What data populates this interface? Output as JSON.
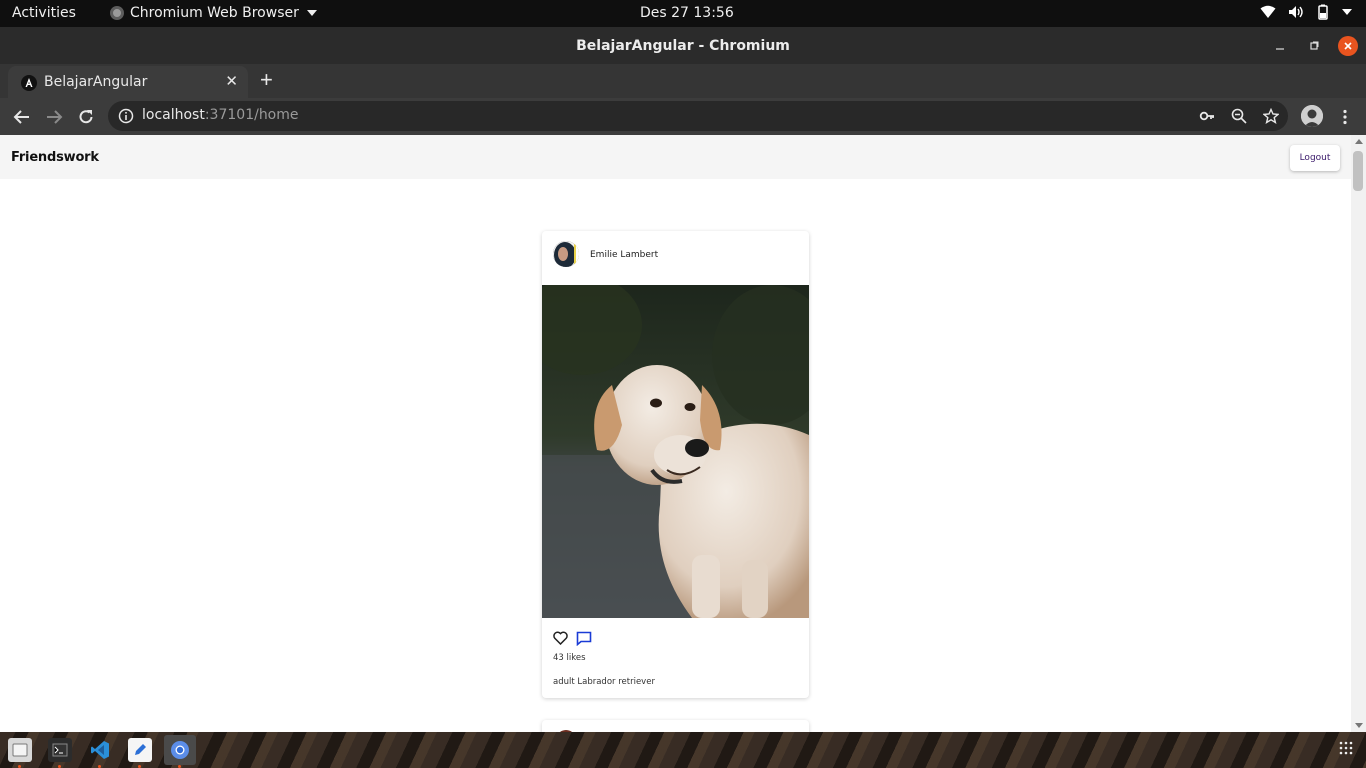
{
  "system": {
    "activities": "Activities",
    "app_menu": "Chromium Web Browser",
    "clock": "Des 27  13:56"
  },
  "window": {
    "title": "BelajarAngular - Chromium"
  },
  "tabs": [
    {
      "label": "BelajarAngular"
    }
  ],
  "omnibox": {
    "host": "localhost",
    "rest": ":37101/home"
  },
  "app": {
    "brand": "Friendswork",
    "logout_label": "Logout"
  },
  "posts": [
    {
      "user": "Emilie Lambert",
      "likes": "43 likes",
      "caption": "adult Labrador retriever"
    }
  ],
  "colors": {
    "accent": "#e9541f",
    "comment_icon": "#1a3bd6"
  },
  "icons": [
    "wifi-icon",
    "volume-icon",
    "battery-icon",
    "key-icon",
    "zoom-icon",
    "star-icon",
    "heart-icon",
    "comment-icon"
  ]
}
